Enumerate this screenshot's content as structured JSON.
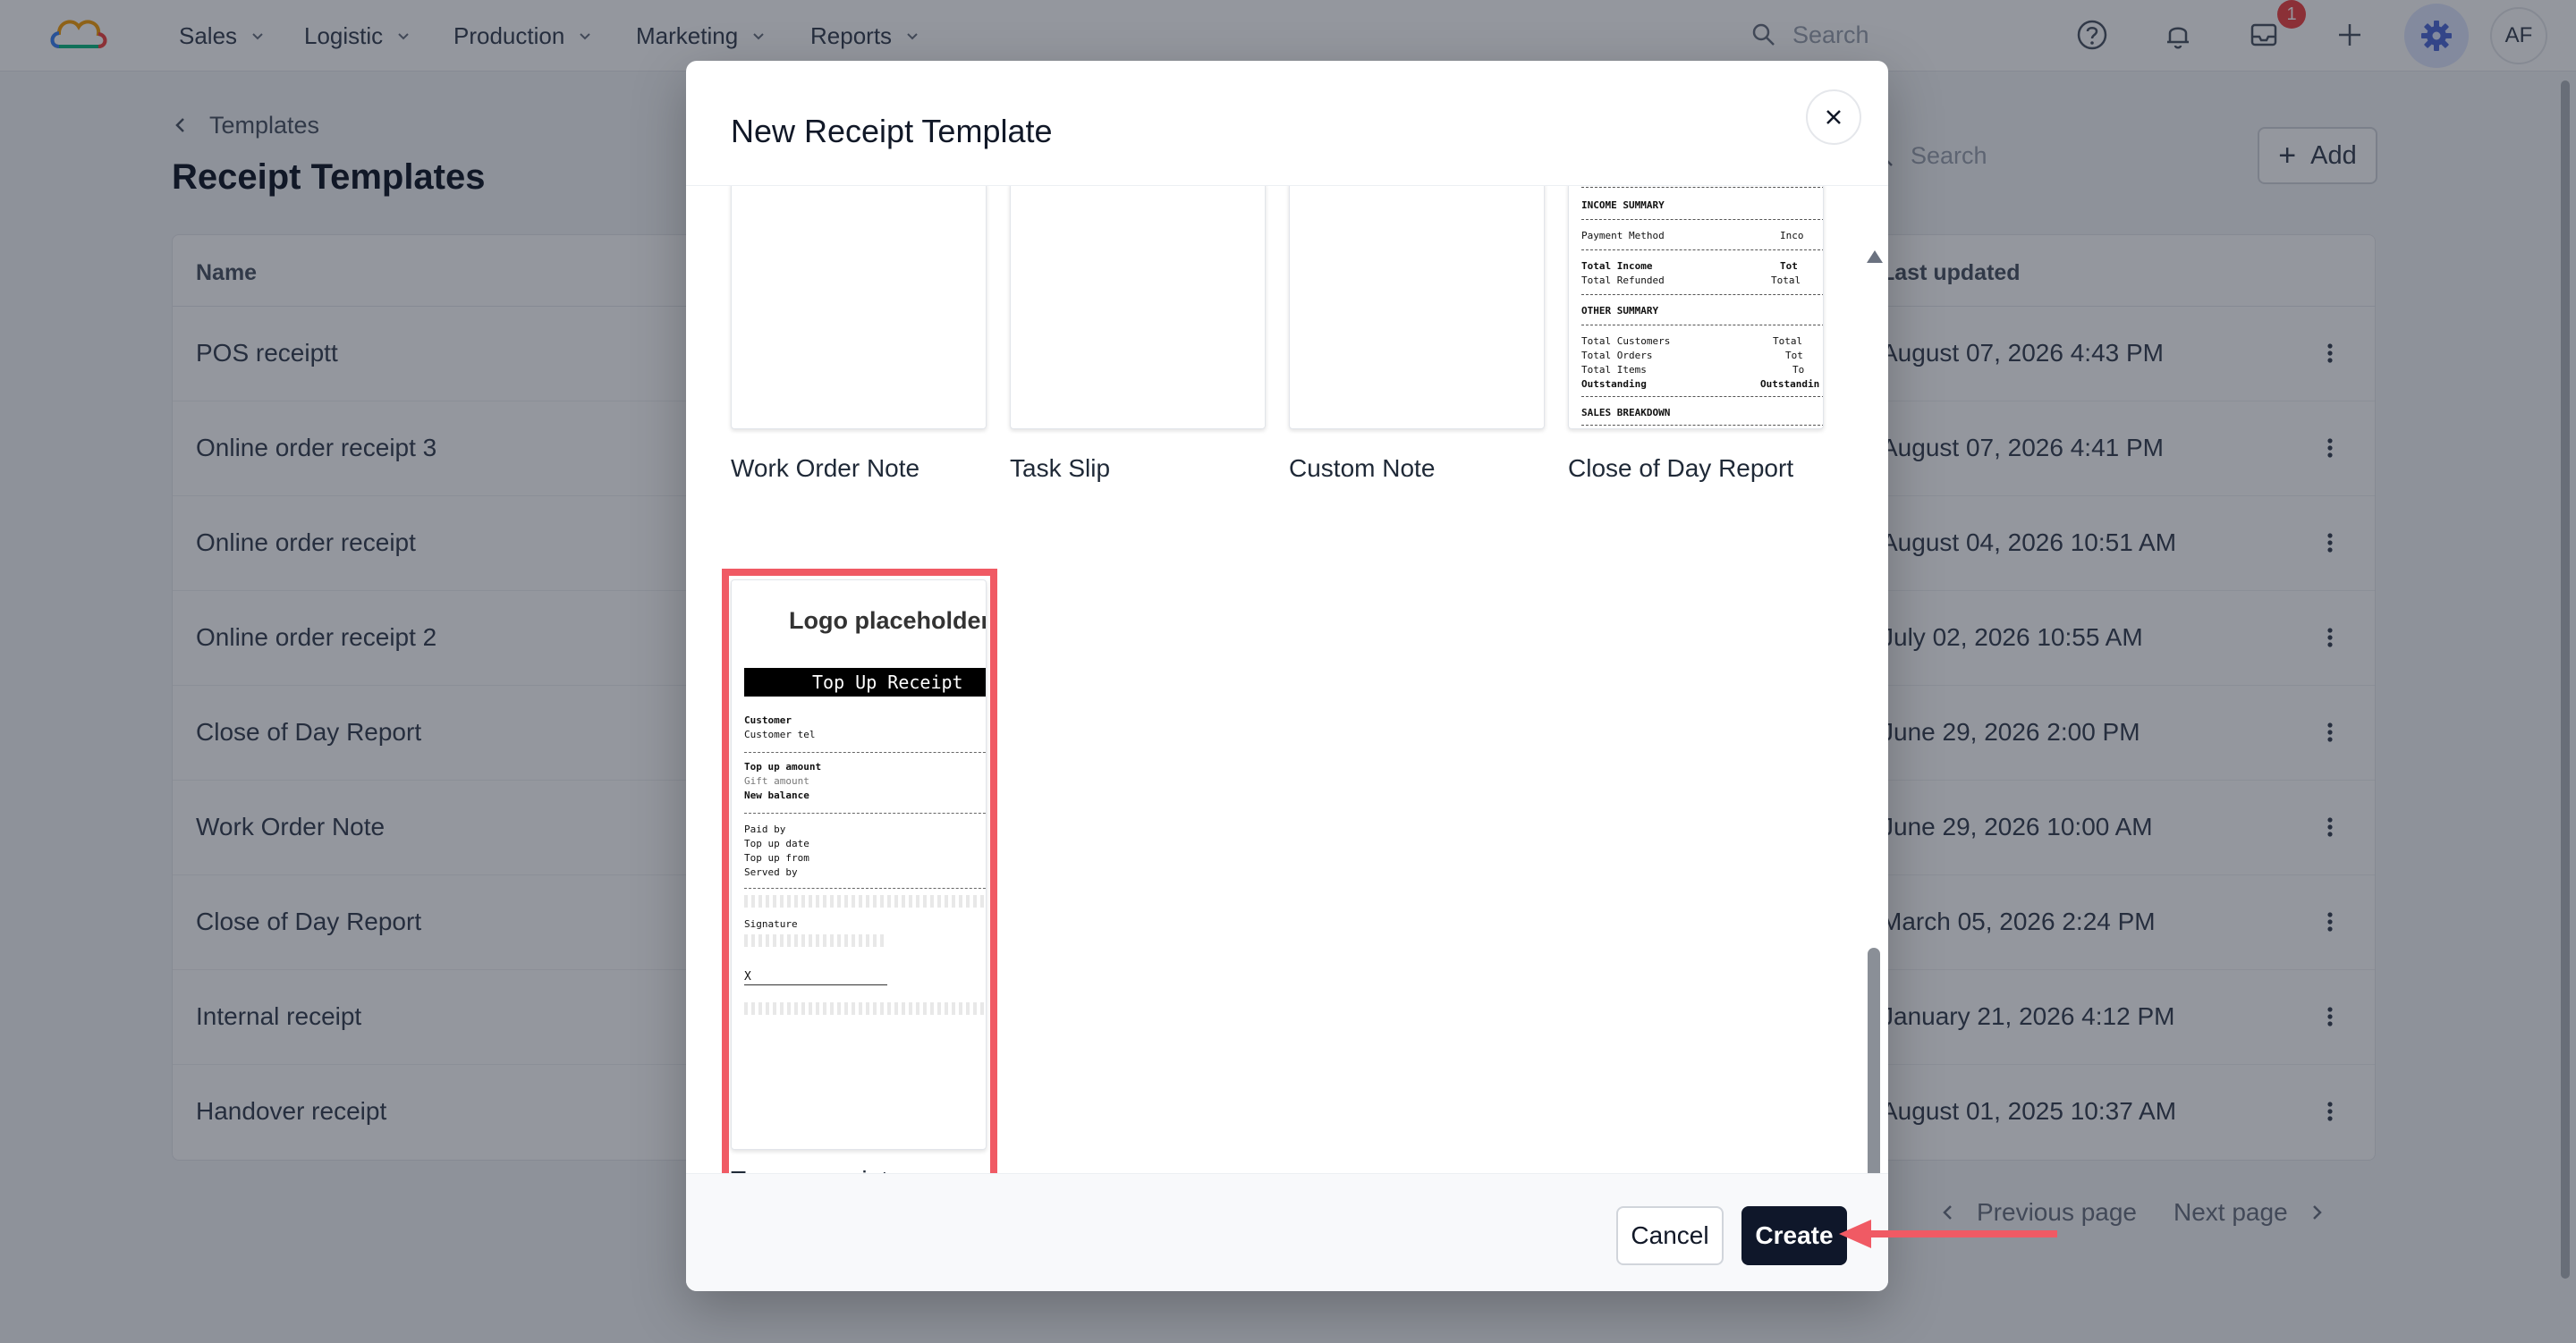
{
  "nav": {
    "items": [
      "Sales",
      "Logistic",
      "Production",
      "Marketing",
      "Reports"
    ],
    "search_placeholder": "Search",
    "notification_badge": "1",
    "avatar_initials": "AF"
  },
  "page": {
    "breadcrumb": "Templates",
    "title": "Receipt Templates",
    "search_placeholder": "Search",
    "add_label": "Add",
    "columns": {
      "name": "Name",
      "updated": "Last updated"
    },
    "rows": [
      {
        "name": "POS receiptt",
        "updated": "August 07, 2026 4:43 PM"
      },
      {
        "name": "Online order receipt 3",
        "updated": "August 07, 2026 4:41 PM"
      },
      {
        "name": "Online order receipt",
        "updated": "August 04, 2026 10:51 AM"
      },
      {
        "name": "Online order receipt 2",
        "updated": "July 02, 2026 10:55 AM"
      },
      {
        "name": "Close of Day Report",
        "updated": "June 29, 2026 2:00 PM"
      },
      {
        "name": "Work Order Note",
        "updated": "June 29, 2026 10:00 AM"
      },
      {
        "name": "Close of Day Report",
        "updated": "March 05, 2026 2:24 PM"
      },
      {
        "name": "Internal receipt",
        "updated": "January 21, 2026 4:12 PM"
      },
      {
        "name": "Handover receipt",
        "updated": "August 01, 2025 10:37 AM"
      }
    ],
    "prev_page": "Previous page",
    "next_page": "Next page"
  },
  "modal": {
    "title": "New Receipt Template",
    "templates": [
      "Work Order Note",
      "Task Slip",
      "Custom Note",
      "Close of Day Report",
      "Top up receipt"
    ],
    "close_of_day_preview": {
      "income_summary": "INCOME SUMMARY",
      "payment_method": "Payment Method",
      "payment_method_col": "Inco",
      "total_income": "Total Income",
      "total_income_col": "Tot",
      "total_refunded": "Total Refunded",
      "total_refunded_col": "Total",
      "other_summary": "OTHER SUMMARY",
      "total_customers": "Total Customers",
      "total_customers_col": "Total",
      "total_orders": "Total Orders",
      "total_orders_col": "Tot",
      "total_items": "Total Items",
      "total_items_col": "To",
      "outstanding": "Outstanding",
      "outstanding_col": "Outstandin",
      "sales_breakdown": "SALES BREAKDOWN"
    },
    "topup_preview": {
      "logo": "Logo placeholder",
      "banner": "Top Up Receipt",
      "customer": "Customer",
      "customer_tel": "Customer tel",
      "top_up_amount": "Top up amount",
      "gift_amount": "Gift amount",
      "new_balance": "New balance",
      "paid_by": "Paid by",
      "top_up_date": "Top up date",
      "top_up_from": "Top up from",
      "served_by": "Served by",
      "signature": "Signature",
      "sign_x": "X"
    },
    "cancel_label": "Cancel",
    "create_label": "Create"
  },
  "colors": {
    "highlight": "#f05a64",
    "primary_button": "#0f172a",
    "badge": "#ef4444"
  }
}
